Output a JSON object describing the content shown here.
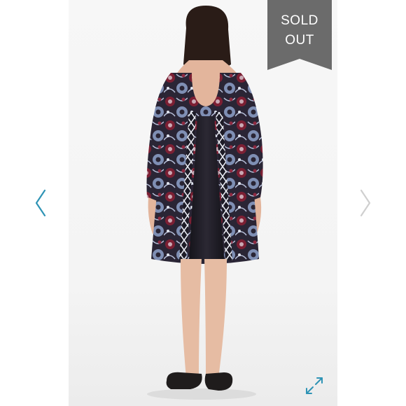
{
  "banner": {
    "line1": "SOLD",
    "line2": "OUT",
    "color": "#6b6b6b"
  },
  "icons": {
    "prev": "chevron-left-icon",
    "next": "chevron-right-icon",
    "expand": "expand-arrows-icon"
  },
  "colors": {
    "accent": "#2f94b5",
    "arrow_inactive": "#cfcfcf",
    "dress_dark": "#1f1d2a",
    "dress_red": "#7c1f33",
    "dress_blue": "#7f8fb4"
  }
}
